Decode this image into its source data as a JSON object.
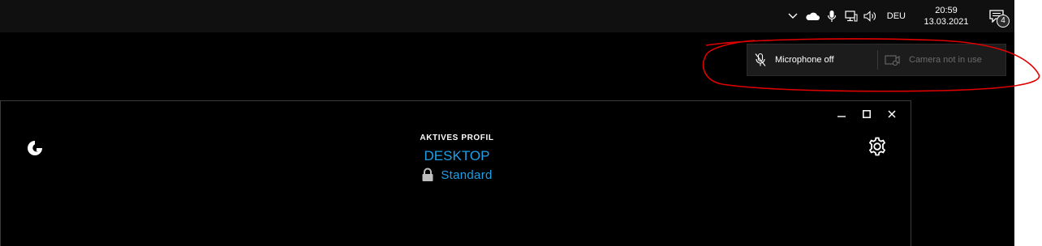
{
  "taskbar": {
    "tray_icons": [
      "chevron-up-icon",
      "onedrive-cloud-icon",
      "microphone-icon",
      "network-icon",
      "volume-icon"
    ],
    "language": "DEU",
    "clock": {
      "time": "20:59",
      "date": "13.03.2021"
    },
    "notifications": {
      "icon": "action-center-icon",
      "count": "4"
    }
  },
  "privacy_toast": {
    "microphone": {
      "icon": "microphone-off-icon",
      "label": "Microphone off"
    },
    "camera": {
      "icon": "camera-off-icon",
      "label": "Camera not in use"
    }
  },
  "annotation": {
    "color": "#e00000"
  },
  "app": {
    "logo": "logitech-g-logo-icon",
    "profile_label": "AKTIVES PROFIL",
    "profile_name": "DESKTOP",
    "profile_sub": "Standard",
    "lock_icon": "lock-icon",
    "settings_icon": "gear-icon",
    "accent_color": "#1ca1e8"
  }
}
